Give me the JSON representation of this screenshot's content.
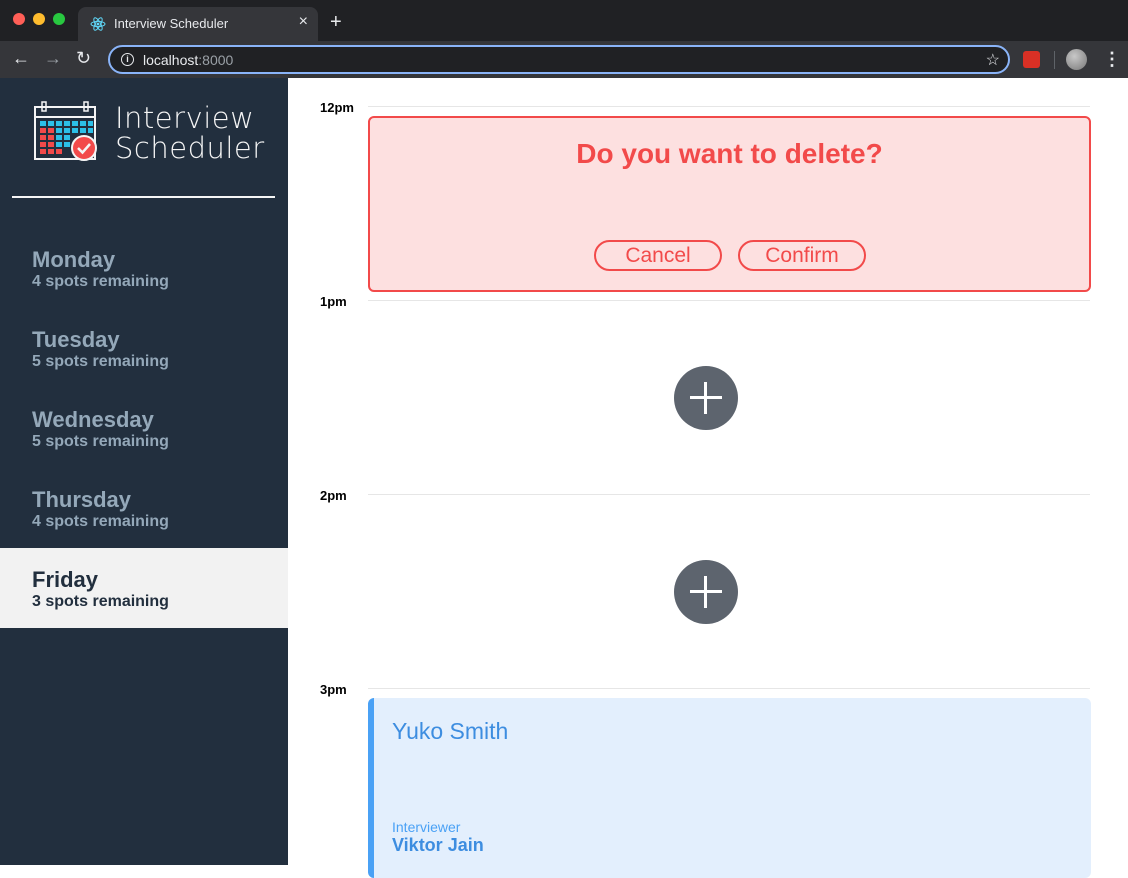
{
  "browser": {
    "tab_title": "Interview Scheduler",
    "tab_close": "×",
    "new_tab": "+",
    "url_host": "localhost",
    "url_port": ":8000",
    "info": "i",
    "back": "←",
    "forward": "→",
    "reload": "↻",
    "star": "☆",
    "menu": "⋮",
    "icons": {
      "tab_favicon": "react-icon",
      "extension": "extension-icon",
      "profile": "profile-avatar-icon"
    }
  },
  "sidebar": {
    "brand_line1": "Interview",
    "brand_line2": "Scheduler",
    "days": [
      {
        "name": "Monday",
        "spots": "4 spots remaining"
      },
      {
        "name": "Tuesday",
        "spots": "5 spots remaining"
      },
      {
        "name": "Wednesday",
        "spots": "5 spots remaining"
      },
      {
        "name": "Thursday",
        "spots": "4 spots remaining"
      },
      {
        "name": "Friday",
        "spots": "3 spots remaining",
        "selected": true
      }
    ]
  },
  "schedule": {
    "times": [
      "12pm",
      "1pm",
      "2pm",
      "3pm"
    ],
    "confirm": {
      "message": "Do you want to delete?",
      "cancel_label": "Cancel",
      "confirm_label": "Confirm"
    },
    "appointment": {
      "student": "Yuko Smith",
      "interviewer_label": "Interviewer",
      "interviewer_name": "Viktor Jain"
    }
  },
  "colors": {
    "sidebar_bg": "#222f3e",
    "danger": "#f24a4a",
    "danger_bg": "#fde0e0",
    "add_button": "#5d646e",
    "appointment_accent": "#4aa1f5",
    "appointment_bg": "#e3effd"
  }
}
